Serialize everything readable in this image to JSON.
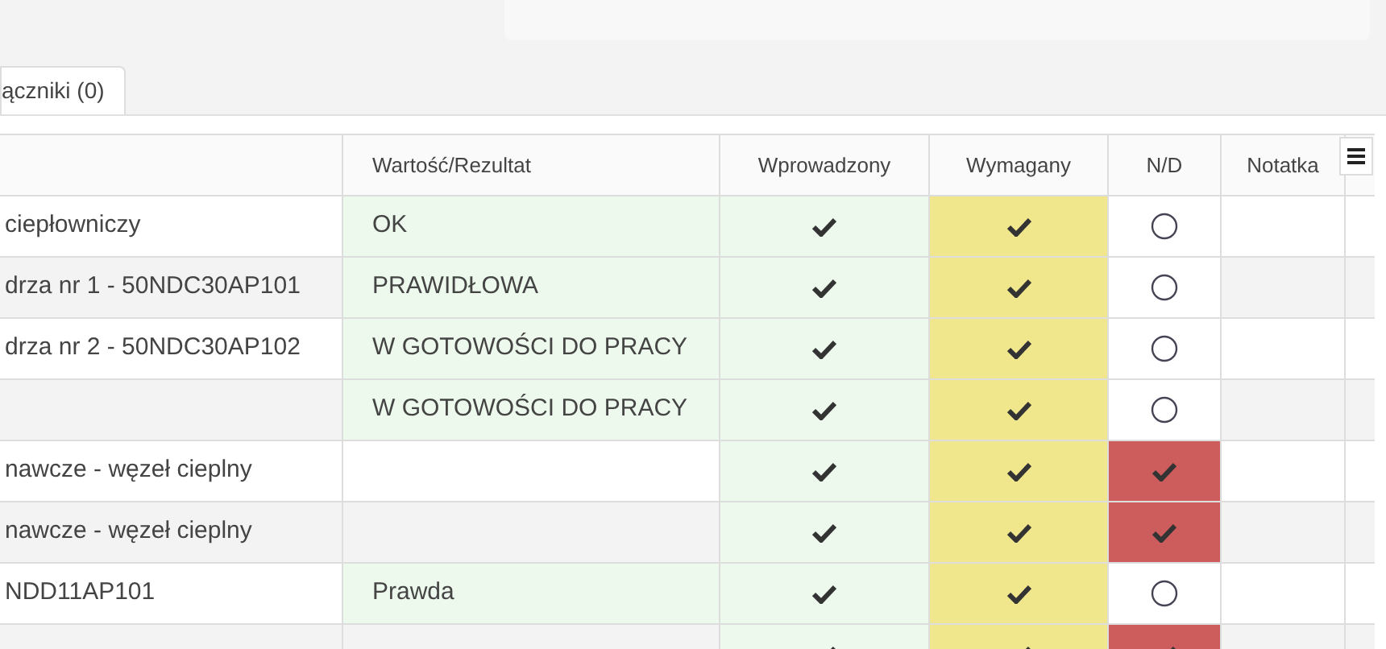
{
  "tabs": [
    {
      "label": "ączniki (0)",
      "selected": true
    }
  ],
  "table": {
    "columns": [
      "",
      "Wartość/Rezultat",
      "Wprowadzony",
      "Wymagany",
      "N/D",
      "Notatka"
    ],
    "rows": [
      {
        "name": "ciepłowniczy",
        "value": "OK",
        "entered": true,
        "required": true,
        "nd": false
      },
      {
        "name": "drza nr 1 - 50NDC30AP101",
        "value": "PRAWIDŁOWA",
        "entered": true,
        "required": true,
        "nd": false
      },
      {
        "name": "drza nr 2 - 50NDC30AP102",
        "value": "W GOTOWOŚCI DO PRACY",
        "entered": true,
        "required": true,
        "nd": false
      },
      {
        "name": "",
        "value": "W GOTOWOŚCI DO PRACY",
        "entered": true,
        "required": true,
        "nd": false
      },
      {
        "name": "nawcze - węzeł cieplny",
        "value": "",
        "entered": true,
        "required": true,
        "nd": true
      },
      {
        "name": "nawcze - węzeł cieplny",
        "value": "",
        "entered": true,
        "required": true,
        "nd": true
      },
      {
        "name": "NDD11AP101",
        "value": "Prawda",
        "entered": true,
        "required": true,
        "nd": false
      },
      {
        "name": "",
        "value": "",
        "entered": true,
        "required": true,
        "nd": true
      }
    ]
  }
}
